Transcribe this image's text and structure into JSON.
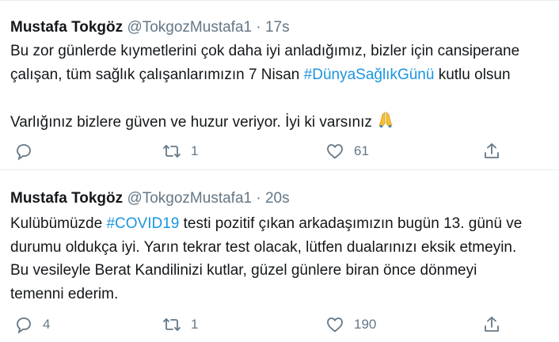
{
  "tweets": [
    {
      "name": "Mustafa Tokgöz",
      "handle": "@TokgozMustafa1",
      "separator": "·",
      "time": "17s",
      "line1": "Bu zor günlerde kıymetlerini çok daha iyi anladığımız, bizler için cansiperane",
      "line2_pre": "çalışan, tüm sağlık çalışanlarımızın 7 Nisan ",
      "line2_tag": "#DünyaSağlıkGünü",
      "line2_post": " kutlu olsun",
      "line3": "Varlığınız bizlere güven ve huzur veriyor. İyi ki varsınız",
      "emoji": "folded-hands-emoji",
      "reply_count": "",
      "retweet_count": "1",
      "like_count": "61"
    },
    {
      "name": "Mustafa Tokgöz",
      "handle": "@TokgozMustafa1",
      "separator": "·",
      "time": "20s",
      "line1_pre": "Kulübümüzde ",
      "line1_tag": "#COVID19",
      "line1_post": " testi pozitif çıkan arkadaşımızın bugün 13. günü ve",
      "line2": "durumu oldukça iyi. Yarın tekrar test olacak, lütfen dualarınızı eksik etmeyin.",
      "line3": "Bu vesileyle Berat Kandilinizi kutlar, güzel günlere biran önce dönmeyi",
      "line4": "temenni ederim.",
      "reply_count": "4",
      "retweet_count": "1",
      "like_count": "190"
    }
  ],
  "icons": {
    "reply": "reply-icon",
    "retweet": "retweet-icon",
    "like": "heart-icon",
    "share": "share-icon"
  },
  "colors": {
    "hashtag": "#1b95e0",
    "secondary_text": "#657786",
    "divider": "#e6ecf0"
  }
}
